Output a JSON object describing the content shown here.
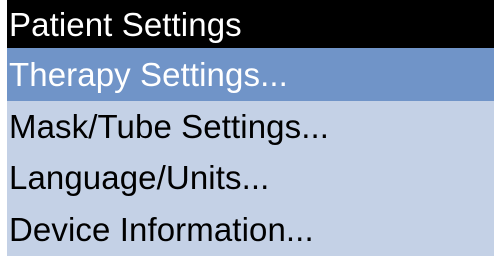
{
  "colors": {
    "title_bar_background": "#000000",
    "title_text": "#ffffff",
    "menu_background": "#c4d1e6",
    "selected_background": "#7094c8",
    "selected_text": "#ffffff",
    "item_text": "#000000"
  },
  "menu": {
    "title": "Patient Settings",
    "selected_index": 0,
    "items": [
      {
        "label": "Therapy Settings..."
      },
      {
        "label": "Mask/Tube Settings..."
      },
      {
        "label": "Language/Units..."
      },
      {
        "label": "Device Information..."
      }
    ]
  }
}
